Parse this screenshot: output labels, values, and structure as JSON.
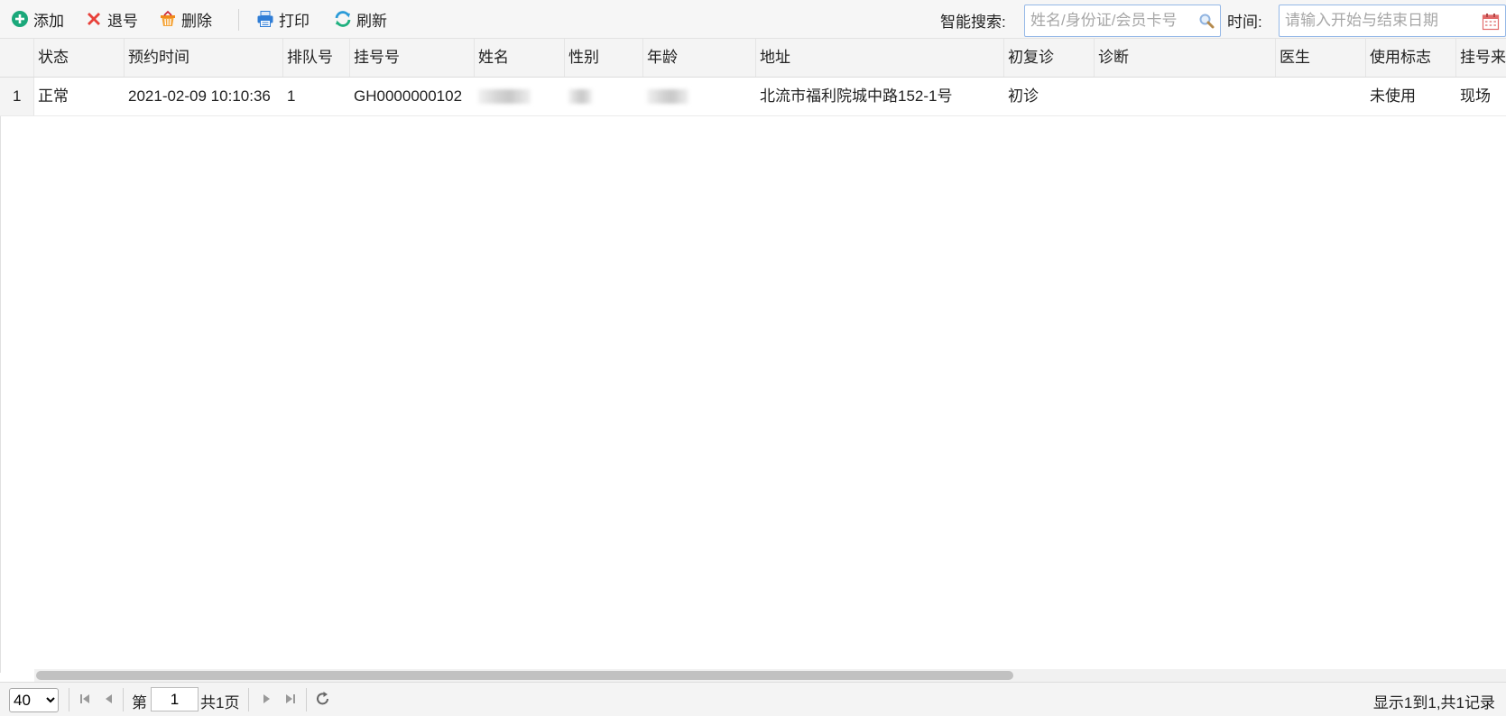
{
  "toolbar": {
    "add": "添加",
    "refund": "退号",
    "delete": "删除",
    "print": "打印",
    "refresh": "刷新",
    "search_label": "智能搜索:",
    "search_placeholder": "姓名/身份证/会员卡号",
    "time_label": "时间:",
    "date_placeholder": "请输入开始与结束日期"
  },
  "icons": {
    "add": "plus-circle-icon",
    "refund": "x-icon",
    "delete": "trash-basket-icon",
    "print": "printer-icon",
    "refresh": "refresh-icon",
    "search": "search-icon",
    "calendar": "calendar-icon"
  },
  "colors": {
    "add": "#1aa87a",
    "refund": "#e8413a",
    "delete": "#f08a1c",
    "print": "#2f7dd6",
    "refresh": "#2b9bd8",
    "input_border": "#95b8e7"
  },
  "table": {
    "columns": [
      "状态",
      "预约时间",
      "排队号",
      "挂号号",
      "姓名",
      "性别",
      "年龄",
      "地址",
      "初复诊",
      "诊断",
      "医生",
      "使用标志",
      "挂号来"
    ],
    "rows": [
      {
        "rownum": "1",
        "status": "正常",
        "appointment_time": "2021-02-09 10:10:36",
        "queue_no": "1",
        "reg_no": "GH0000000102",
        "name": "",
        "gender": "",
        "age": "",
        "address": "北流市福利院城中路152-1号",
        "visit_type": "初诊",
        "diagnosis": "",
        "doctor": "",
        "usage_flag": "未使用",
        "source": "现场"
      }
    ]
  },
  "pager": {
    "page_size": "40",
    "page_prefix": "第",
    "current_page": "1",
    "total_pages": "共1页",
    "summary": "显示1到1,共1记录"
  }
}
